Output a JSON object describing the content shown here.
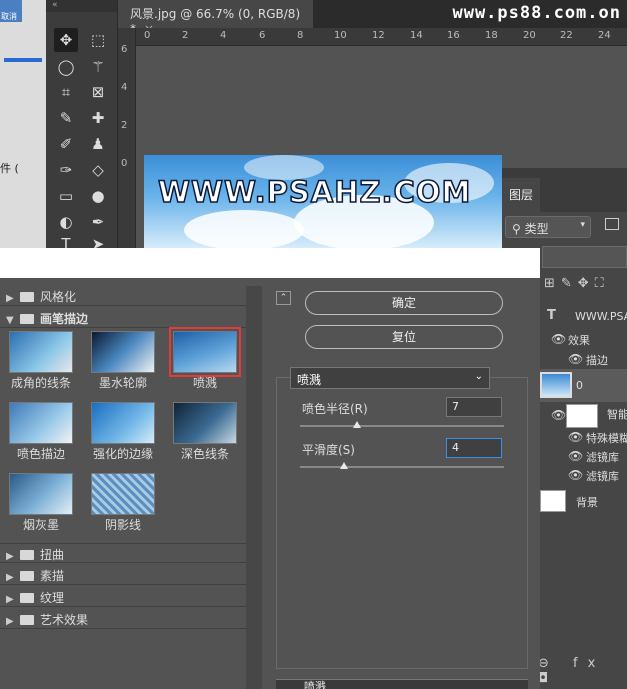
{
  "tab": {
    "title": "风景.jpg @ 66.7% (0, RGB/8) *",
    "close": "×"
  },
  "watermark": "www.ps88.com.on",
  "left_window": {
    "cancel": "取消",
    "file_fragment": "件 ("
  },
  "toolbar": {
    "collapse": "«",
    "tools": [
      "move-tool",
      "marquee-tool",
      "lasso-tool",
      "magic-wand-tool",
      "crop-tool",
      "frame-tool",
      "eyedropper-tool",
      "healing-tool",
      "brush-tool",
      "stamp-tool",
      "history-brush-tool",
      "eraser-tool",
      "gradient-tool",
      "blur-tool",
      "dodge-tool",
      "pen-tool",
      "type-tool",
      "path-select-tool"
    ]
  },
  "ruler": {
    "h": [
      "0",
      "2",
      "4",
      "6",
      "8",
      "10",
      "12",
      "14",
      "16",
      "18",
      "20",
      "22",
      "24"
    ],
    "v": [
      "6",
      "4",
      "2",
      "0"
    ]
  },
  "canvas": {
    "title": "WWW.PSAHZ.COM"
  },
  "layers": {
    "tab": "图层",
    "kind": "类型",
    "rows": {
      "text_layer": "WWW.PSA",
      "effects": "效果",
      "stroke": "描边",
      "layer0": "0",
      "smart": "智能",
      "special_blur": "特殊模糊",
      "filter1": "滤镜库",
      "filter2": "滤镜库",
      "background": "背景"
    },
    "bottom_icons": "⊖ fx ◘"
  },
  "gallery": {
    "categories": [
      {
        "label": "风格化",
        "open": false
      },
      {
        "label": "画笔描边",
        "open": true
      },
      {
        "label": "扭曲",
        "open": false
      },
      {
        "label": "素描",
        "open": false
      },
      {
        "label": "纹理",
        "open": false
      },
      {
        "label": "艺术效果",
        "open": false
      }
    ],
    "thumbs": [
      "成角的线条",
      "墨水轮廓",
      "喷溅",
      "喷色描边",
      "强化的边缘",
      "深色线条",
      "烟灰墨",
      "阴影线"
    ],
    "selected": "喷溅"
  },
  "buttons": {
    "ok": "确定",
    "reset": "复位"
  },
  "settings": {
    "filter": "喷溅",
    "spray_radius_label": "喷色半径(R)",
    "spray_radius_value": 7,
    "spray_radius_max": 25,
    "smoothness_label": "平滑度(S)",
    "smoothness_value": 4,
    "smoothness_max": 15,
    "bottom_item": "喷溅"
  }
}
